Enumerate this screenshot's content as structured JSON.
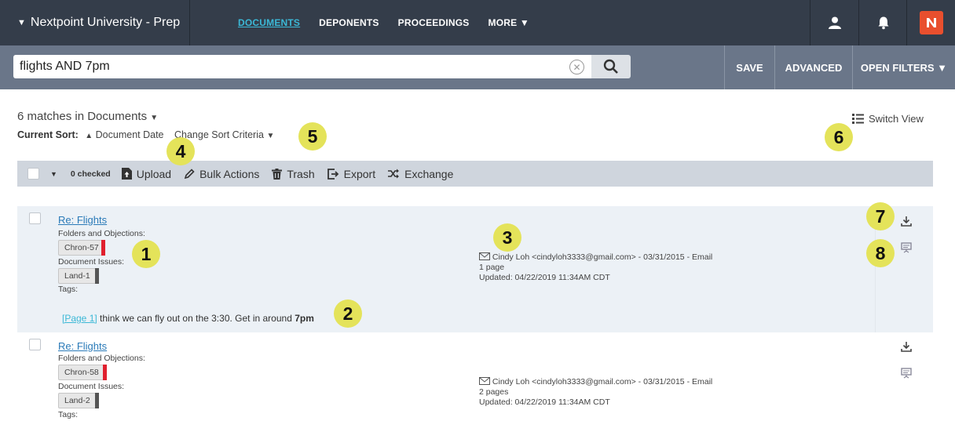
{
  "topnav": {
    "workspace": "Nextpoint University - Prep",
    "links": [
      "DOCUMENTS",
      "DEPONENTS",
      "PROCEEDINGS",
      "MORE ▼"
    ]
  },
  "search": {
    "query": "flights AND 7pm",
    "buttons": [
      "SAVE",
      "ADVANCED",
      "OPEN FILTERS ▼"
    ]
  },
  "summary": {
    "matches_prefix": "6 matches in",
    "scope": "Documents",
    "sort_label": "Current Sort:",
    "sort_value": "Document Date",
    "change_sort": "Change Sort Criteria",
    "switch_view": "Switch View"
  },
  "toolbar": {
    "checked": "0 checked",
    "upload": "Upload",
    "bulk_actions": "Bulk Actions",
    "trash": "Trash",
    "export": "Export",
    "exchange": "Exchange"
  },
  "results": [
    {
      "title": "Re: Flights",
      "folders_label": "Folders and Objections:",
      "folder_chip": "Chron-57",
      "issues_label": "Document Issues:",
      "issue_chip": "Land-1",
      "tags_label": "Tags:",
      "author": "Cindy Loh <cindyloh3333@gmail.com> - 03/31/2015 - Email",
      "pages": "1 page",
      "updated": "Updated: 04/22/2019 11:34AM CDT",
      "snippet_page": "[Page 1]",
      "snippet_text": "think we can fly out on the 3:30. Get in around",
      "snippet_hit": "7pm"
    },
    {
      "title": "Re: Flights",
      "folders_label": "Folders and Objections:",
      "folder_chip": "Chron-58",
      "issues_label": "Document Issues:",
      "issue_chip": "Land-2",
      "tags_label": "Tags:",
      "author": "Cindy Loh <cindyloh3333@gmail.com> - 03/31/2015 - Email",
      "pages": "2 pages",
      "updated": "Updated: 04/22/2019 11:34AM CDT"
    }
  ],
  "callouts": [
    "1",
    "2",
    "3",
    "4",
    "5",
    "6",
    "7",
    "8"
  ],
  "colors": {
    "nav_bg": "#343d4a",
    "search_bg": "#6a7689",
    "accent": "#3bb8d6",
    "folder_marker": "#e0202e",
    "issue_marker": "#555555",
    "callout": "#e4e35a"
  }
}
